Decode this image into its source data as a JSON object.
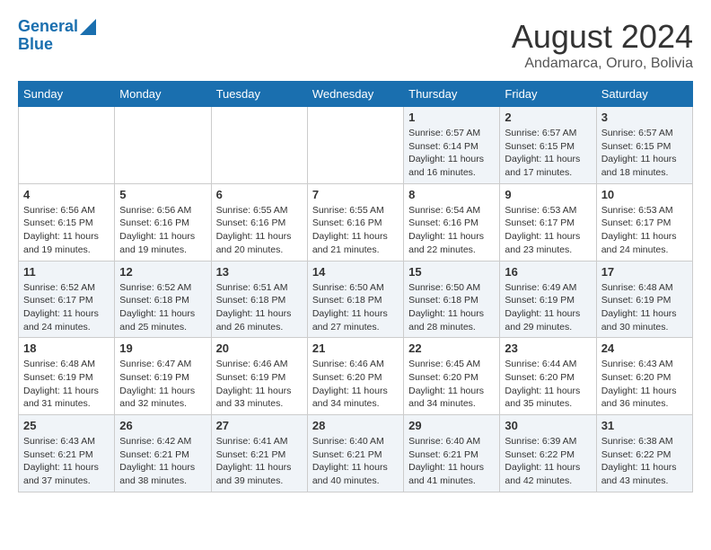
{
  "header": {
    "logo_line1": "General",
    "logo_line2": "Blue",
    "title": "August 2024",
    "subtitle": "Andamarca, Oruro, Bolivia"
  },
  "days_of_week": [
    "Sunday",
    "Monday",
    "Tuesday",
    "Wednesday",
    "Thursday",
    "Friday",
    "Saturday"
  ],
  "weeks": [
    [
      {
        "day": "",
        "info": ""
      },
      {
        "day": "",
        "info": ""
      },
      {
        "day": "",
        "info": ""
      },
      {
        "day": "",
        "info": ""
      },
      {
        "day": "1",
        "info": "Sunrise: 6:57 AM\nSunset: 6:14 PM\nDaylight: 11 hours\nand 16 minutes."
      },
      {
        "day": "2",
        "info": "Sunrise: 6:57 AM\nSunset: 6:15 PM\nDaylight: 11 hours\nand 17 minutes."
      },
      {
        "day": "3",
        "info": "Sunrise: 6:57 AM\nSunset: 6:15 PM\nDaylight: 11 hours\nand 18 minutes."
      }
    ],
    [
      {
        "day": "4",
        "info": "Sunrise: 6:56 AM\nSunset: 6:15 PM\nDaylight: 11 hours\nand 19 minutes."
      },
      {
        "day": "5",
        "info": "Sunrise: 6:56 AM\nSunset: 6:16 PM\nDaylight: 11 hours\nand 19 minutes."
      },
      {
        "day": "6",
        "info": "Sunrise: 6:55 AM\nSunset: 6:16 PM\nDaylight: 11 hours\nand 20 minutes."
      },
      {
        "day": "7",
        "info": "Sunrise: 6:55 AM\nSunset: 6:16 PM\nDaylight: 11 hours\nand 21 minutes."
      },
      {
        "day": "8",
        "info": "Sunrise: 6:54 AM\nSunset: 6:16 PM\nDaylight: 11 hours\nand 22 minutes."
      },
      {
        "day": "9",
        "info": "Sunrise: 6:53 AM\nSunset: 6:17 PM\nDaylight: 11 hours\nand 23 minutes."
      },
      {
        "day": "10",
        "info": "Sunrise: 6:53 AM\nSunset: 6:17 PM\nDaylight: 11 hours\nand 24 minutes."
      }
    ],
    [
      {
        "day": "11",
        "info": "Sunrise: 6:52 AM\nSunset: 6:17 PM\nDaylight: 11 hours\nand 24 minutes."
      },
      {
        "day": "12",
        "info": "Sunrise: 6:52 AM\nSunset: 6:18 PM\nDaylight: 11 hours\nand 25 minutes."
      },
      {
        "day": "13",
        "info": "Sunrise: 6:51 AM\nSunset: 6:18 PM\nDaylight: 11 hours\nand 26 minutes."
      },
      {
        "day": "14",
        "info": "Sunrise: 6:50 AM\nSunset: 6:18 PM\nDaylight: 11 hours\nand 27 minutes."
      },
      {
        "day": "15",
        "info": "Sunrise: 6:50 AM\nSunset: 6:18 PM\nDaylight: 11 hours\nand 28 minutes."
      },
      {
        "day": "16",
        "info": "Sunrise: 6:49 AM\nSunset: 6:19 PM\nDaylight: 11 hours\nand 29 minutes."
      },
      {
        "day": "17",
        "info": "Sunrise: 6:48 AM\nSunset: 6:19 PM\nDaylight: 11 hours\nand 30 minutes."
      }
    ],
    [
      {
        "day": "18",
        "info": "Sunrise: 6:48 AM\nSunset: 6:19 PM\nDaylight: 11 hours\nand 31 minutes."
      },
      {
        "day": "19",
        "info": "Sunrise: 6:47 AM\nSunset: 6:19 PM\nDaylight: 11 hours\nand 32 minutes."
      },
      {
        "day": "20",
        "info": "Sunrise: 6:46 AM\nSunset: 6:19 PM\nDaylight: 11 hours\nand 33 minutes."
      },
      {
        "day": "21",
        "info": "Sunrise: 6:46 AM\nSunset: 6:20 PM\nDaylight: 11 hours\nand 34 minutes."
      },
      {
        "day": "22",
        "info": "Sunrise: 6:45 AM\nSunset: 6:20 PM\nDaylight: 11 hours\nand 34 minutes."
      },
      {
        "day": "23",
        "info": "Sunrise: 6:44 AM\nSunset: 6:20 PM\nDaylight: 11 hours\nand 35 minutes."
      },
      {
        "day": "24",
        "info": "Sunrise: 6:43 AM\nSunset: 6:20 PM\nDaylight: 11 hours\nand 36 minutes."
      }
    ],
    [
      {
        "day": "25",
        "info": "Sunrise: 6:43 AM\nSunset: 6:21 PM\nDaylight: 11 hours\nand 37 minutes."
      },
      {
        "day": "26",
        "info": "Sunrise: 6:42 AM\nSunset: 6:21 PM\nDaylight: 11 hours\nand 38 minutes."
      },
      {
        "day": "27",
        "info": "Sunrise: 6:41 AM\nSunset: 6:21 PM\nDaylight: 11 hours\nand 39 minutes."
      },
      {
        "day": "28",
        "info": "Sunrise: 6:40 AM\nSunset: 6:21 PM\nDaylight: 11 hours\nand 40 minutes."
      },
      {
        "day": "29",
        "info": "Sunrise: 6:40 AM\nSunset: 6:21 PM\nDaylight: 11 hours\nand 41 minutes."
      },
      {
        "day": "30",
        "info": "Sunrise: 6:39 AM\nSunset: 6:22 PM\nDaylight: 11 hours\nand 42 minutes."
      },
      {
        "day": "31",
        "info": "Sunrise: 6:38 AM\nSunset: 6:22 PM\nDaylight: 11 hours\nand 43 minutes."
      }
    ]
  ]
}
